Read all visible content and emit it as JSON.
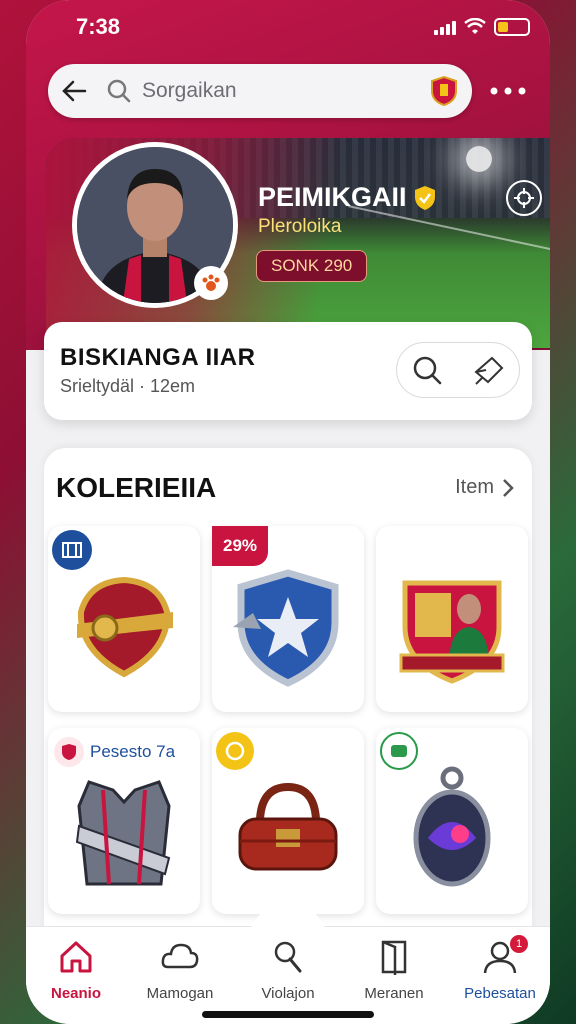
{
  "status_bar": {
    "time": "7:38"
  },
  "search": {
    "placeholder": "Sorgaikan"
  },
  "profile": {
    "name": "PEIMIKGAII",
    "subtitle": "Pleroloika",
    "rank": "SONK 290"
  },
  "info_card": {
    "title": "BISKIANGA IIAR",
    "subtitle": "Srieltydäl · 12em"
  },
  "collection": {
    "title": "KOLERIEIIA",
    "link_label": "Item",
    "items": [
      {
        "tag": "",
        "tag_type": "blue",
        "icon": "red-shield-icon"
      },
      {
        "tag": "29%",
        "tag_type": "red",
        "icon": "blue-star-shield-icon"
      },
      {
        "tag": "",
        "tag_type": "none",
        "icon": "player-crest-icon"
      },
      {
        "tag": "Pesesto 7a",
        "tag_type": "label",
        "icon": "armor-vest-icon"
      },
      {
        "tag": "",
        "tag_type": "gold",
        "icon": "red-bag-icon"
      },
      {
        "tag": "",
        "tag_type": "green",
        "icon": "gem-pendant-icon"
      }
    ]
  },
  "nav": {
    "items": [
      {
        "label": "Neanio",
        "icon": "home-icon"
      },
      {
        "label": "Mamogan",
        "icon": "cloud-icon"
      },
      {
        "label": "Violajon",
        "icon": "ball-icon"
      },
      {
        "label": "Meranen",
        "icon": "door-icon"
      },
      {
        "label": "Pebesatan",
        "icon": "profile-icon",
        "badge": "1"
      }
    ]
  },
  "colors": {
    "accent": "#c8143f",
    "brand_dark": "#8d0f33",
    "link_blue": "#1e4f9c"
  }
}
